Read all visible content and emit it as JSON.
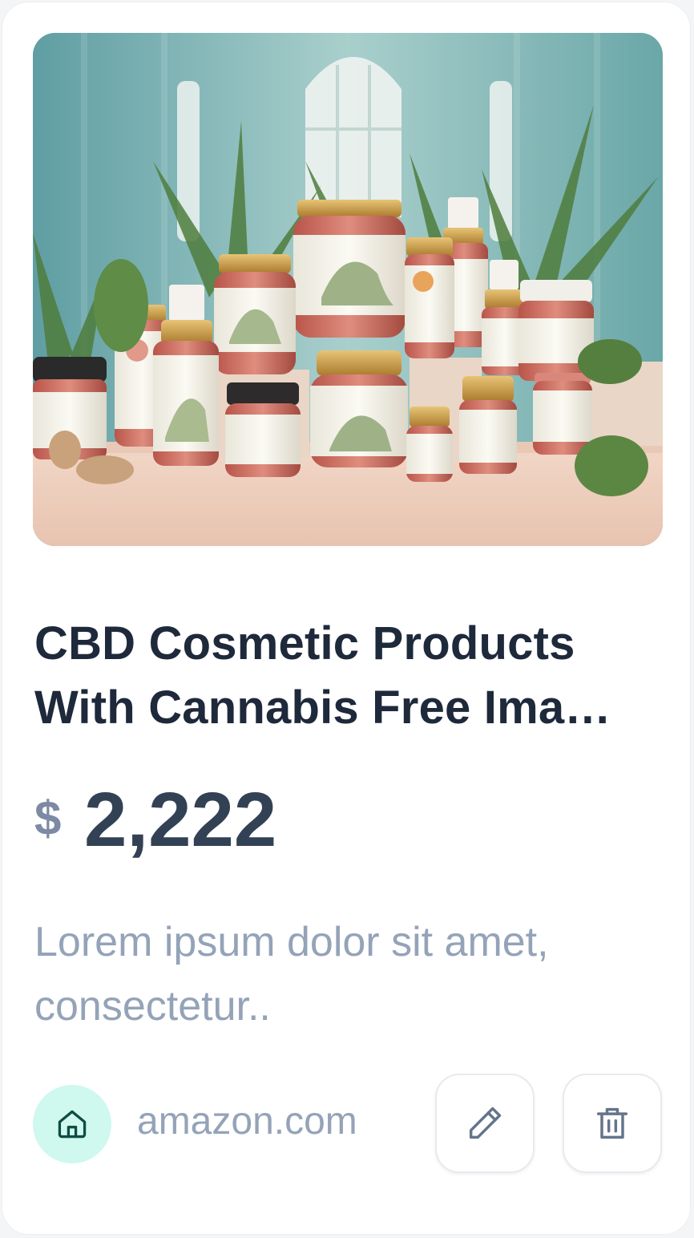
{
  "product": {
    "title": "CBD Cosmetic Products With Cannabis Free Ima…",
    "currency": "$",
    "price": "2,222",
    "description": "Lorem ipsum dolor sit amet, consectetur..",
    "store": "amazon.com"
  },
  "icons": {
    "store": "home-icon",
    "edit": "pencil-icon",
    "delete": "trash-icon"
  },
  "colors": {
    "title": "#1e293b",
    "price": "#334155",
    "muted": "#94a3b8",
    "store_badge": "#cff8ef",
    "store_icon": "#0f4c44"
  }
}
